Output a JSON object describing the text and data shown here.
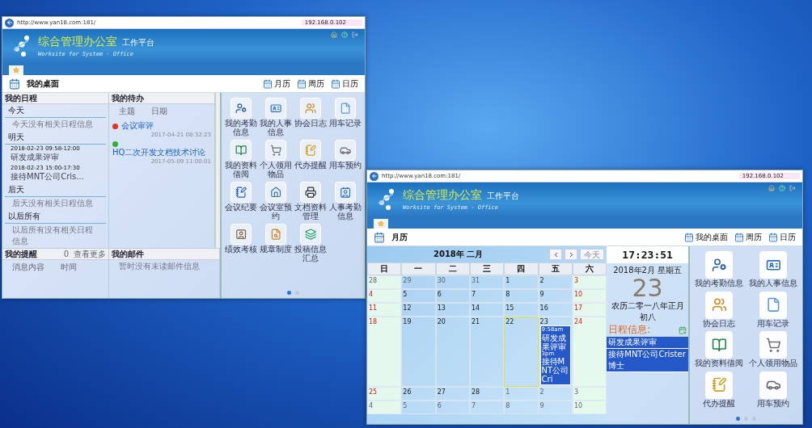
{
  "window_1": {
    "address": {
      "url": "http://www.yan18.com:181/",
      "host": "192.168.0.102"
    },
    "header": {
      "title": "综合管理办公室",
      "subtitle": "工作平台",
      "tagline": "Worksite for System - Office"
    },
    "toolbar": {
      "page_title": "我的桌面",
      "views": [
        {
          "label": "月历"
        },
        {
          "label": "周历"
        },
        {
          "label": "日历"
        }
      ]
    },
    "schedule": {
      "title": "我的日程",
      "groups": [
        {
          "label": "今天",
          "items": [
            {
              "kind": "note",
              "text": "今天没有相关日程信息"
            }
          ]
        },
        {
          "label": "明天",
          "items": [
            {
              "kind": "event",
              "time": "2018-02-23 09:58-12:00",
              "text": "研发成果评审"
            },
            {
              "kind": "event",
              "time": "2018-02-23 15:00-17:30",
              "text": "接待MNT公司Cris..."
            }
          ]
        },
        {
          "label": "后天",
          "items": [
            {
              "kind": "note",
              "text": "后天没有相关日程信息"
            }
          ]
        },
        {
          "label": "以后所有",
          "items": [
            {
              "kind": "note",
              "text": "以后所有没有相关日程信息"
            }
          ]
        }
      ]
    },
    "todo": {
      "title": "我的待办",
      "columns": [
        "主题",
        "日期"
      ],
      "rows": [
        {
          "subject": "会议审评",
          "date": "2017-04-21 08:32:23",
          "color": "#e03020"
        },
        {
          "subject": "HQ二次开发文档技术讨论",
          "date": "2017-05-09 11:00:01",
          "color": "#30b030"
        }
      ]
    },
    "reminders": {
      "title": "我的提醒",
      "count": "0",
      "more": "查看更多",
      "columns": [
        "消息内容",
        "时间"
      ]
    },
    "mail": {
      "title": "我的邮件",
      "message": "暂时没有未读邮件信息"
    },
    "apps": [
      "我的考勤信息",
      "我的人事信息",
      "协会日志",
      "用车记录",
      "我的资料借阅",
      "个人领用物品",
      "代办提醒",
      "用车预约",
      "会议纪要",
      "会议室预约",
      "文档资料管理",
      "人事考勤信息",
      "绩效考核",
      "规章制度",
      "投稿信息汇总"
    ],
    "pager": [
      {
        "selected": true
      },
      {
        "selected": false
      }
    ]
  },
  "window_2": {
    "address": {
      "url": "http://www.yan18.com:181/",
      "host": "192.168.0.102"
    },
    "header": {
      "title": "综合管理办公室",
      "subtitle": "工作平台",
      "tagline": "Worksite for System - Office"
    },
    "toolbar": {
      "page_title": "月历",
      "views": [
        {
          "label": "我的桌面"
        },
        {
          "label": "周历"
        },
        {
          "label": "日历"
        }
      ]
    },
    "calendar": {
      "title": "2018年 二月",
      "today_button": "今天",
      "weekdays": [
        "日",
        "一",
        "二",
        "三",
        "四",
        "五",
        "六"
      ],
      "weeks": [
        [
          {
            "day": "28",
            "muted": true,
            "highlighted": false
          },
          {
            "day": "29",
            "muted": true,
            "highlighted": false
          },
          {
            "day": "30",
            "muted": true,
            "highlighted": false
          },
          {
            "day": "31",
            "muted": true,
            "highlighted": false
          },
          {
            "day": "1",
            "muted": false,
            "highlighted": false
          },
          {
            "day": "2",
            "muted": false,
            "highlighted": false
          },
          {
            "day": "3",
            "muted": false,
            "highlighted": false
          }
        ],
        [
          {
            "day": "4",
            "muted": false,
            "highlighted": false
          },
          {
            "day": "5",
            "muted": false,
            "highlighted": false
          },
          {
            "day": "6",
            "muted": false,
            "highlighted": false
          },
          {
            "day": "7",
            "muted": false,
            "highlighted": false
          },
          {
            "day": "8",
            "muted": false,
            "highlighted": false
          },
          {
            "day": "9",
            "muted": false,
            "highlighted": false
          },
          {
            "day": "10",
            "muted": false,
            "highlighted": false
          }
        ],
        [
          {
            "day": "11",
            "muted": false,
            "highlighted": false
          },
          {
            "day": "12",
            "muted": false,
            "highlighted": false
          },
          {
            "day": "13",
            "muted": false,
            "highlighted": false
          },
          {
            "day": "14",
            "muted": false,
            "highlighted": false
          },
          {
            "day": "15",
            "muted": false,
            "highlighted": false
          },
          {
            "day": "16",
            "muted": false,
            "highlighted": false
          },
          {
            "day": "17",
            "muted": false,
            "highlighted": false
          }
        ],
        [
          {
            "day": "18",
            "muted": false,
            "highlighted": false
          },
          {
            "day": "19",
            "muted": false,
            "highlighted": false
          },
          {
            "day": "20",
            "muted": false,
            "highlighted": false
          },
          {
            "day": "21",
            "muted": false,
            "highlighted": false
          },
          {
            "day": "22",
            "muted": false,
            "highlighted": true
          },
          {
            "day": "23",
            "muted": false,
            "highlighted": false,
            "events": [
              {
                "time": "9:58am",
                "title": "研发成果评审"
              },
              {
                "time": "3pm",
                "title": "接待MNT公司Cri"
              }
            ]
          },
          {
            "day": "24",
            "muted": false,
            "highlighted": false
          }
        ],
        [
          {
            "day": "25",
            "muted": false,
            "highlighted": false
          },
          {
            "day": "26",
            "muted": false,
            "highlighted": false
          },
          {
            "day": "27",
            "muted": false,
            "highlighted": false
          },
          {
            "day": "28",
            "muted": false,
            "highlighted": false
          },
          {
            "day": "1",
            "muted": true,
            "highlighted": false
          },
          {
            "day": "2",
            "muted": true,
            "highlighted": false
          },
          {
            "day": "3",
            "muted": true,
            "highlighted": false
          }
        ],
        [
          {
            "day": "4",
            "muted": true,
            "highlighted": false
          },
          {
            "day": "5",
            "muted": true,
            "highlighted": false
          },
          {
            "day": "6",
            "muted": true,
            "highlighted": false
          },
          {
            "day": "7",
            "muted": true,
            "highlighted": false
          },
          {
            "day": "8",
            "muted": true,
            "highlighted": false
          },
          {
            "day": "9",
            "muted": true,
            "highlighted": false
          },
          {
            "day": "10",
            "muted": true,
            "highlighted": false
          }
        ]
      ]
    },
    "clock": {
      "time": "17:23:51",
      "date": "2018年2月 星期五",
      "day": "23",
      "lunar": "农历二零一八年正月初八",
      "agenda_title": "日程信息:",
      "agenda": [
        "研发成果评审",
        "接待MNT公司Crister博士"
      ]
    },
    "apps": [
      "我的考勤信息",
      "我的人事信息",
      "协会日志",
      "用车记录",
      "我的资料借阅",
      "个人领用物品",
      "代办提醒",
      "用车预约"
    ],
    "pager": [
      {
        "selected": true
      },
      {
        "selected": false
      },
      {
        "selected": false
      }
    ]
  }
}
